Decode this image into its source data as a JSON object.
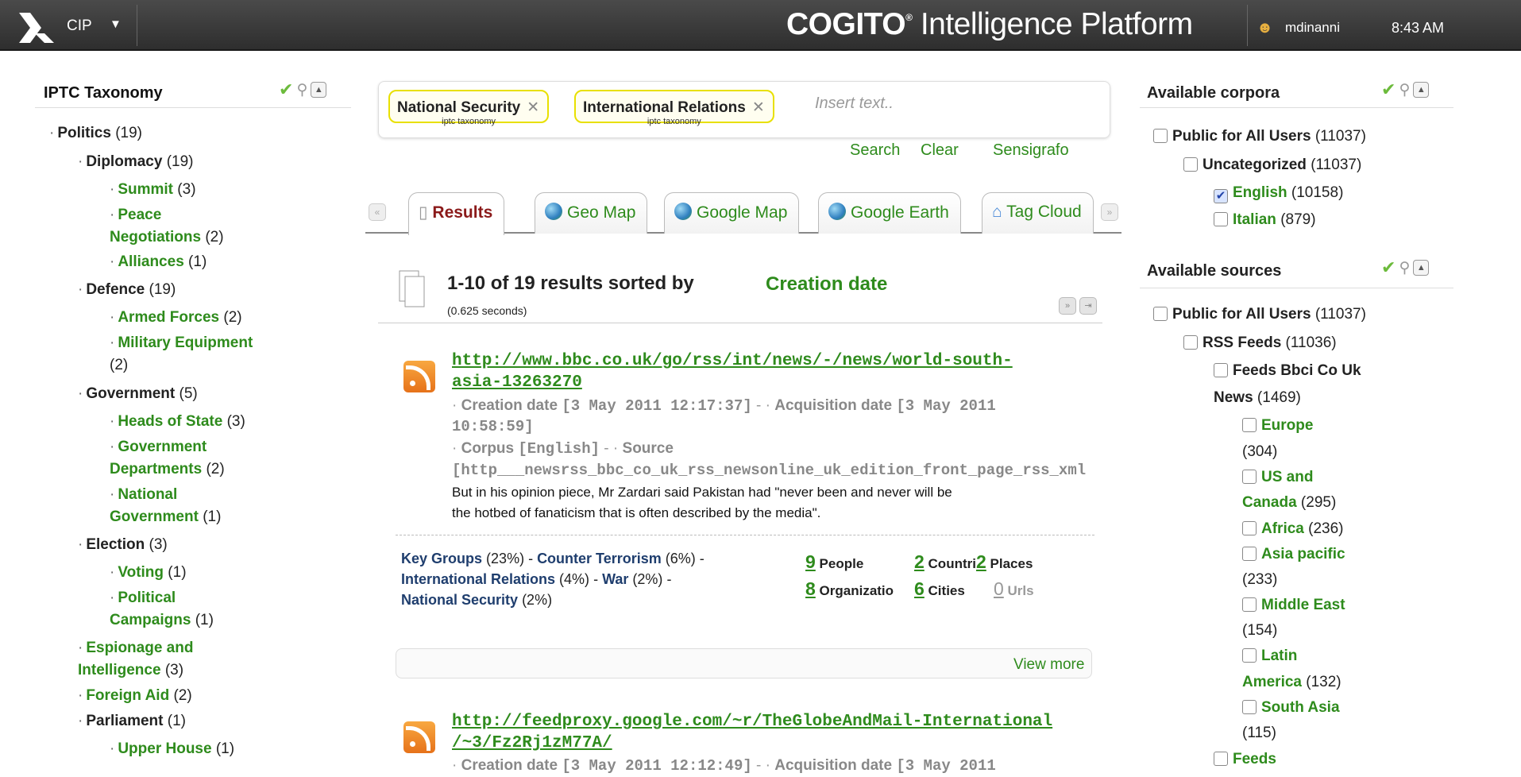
{
  "topbar": {
    "app_switcher": "CIP",
    "title_brand": "COGITO",
    "title_reg": "®",
    "title_rest": "Intelligence Platform",
    "username": "mdinanni",
    "time": "8:43 AM"
  },
  "left": {
    "title": "IPTC Taxonomy",
    "items": [
      {
        "label": "Politics",
        "count": "(19)"
      },
      {
        "label": "Diplomacy",
        "count": "(19)"
      },
      {
        "label": "Summit",
        "count": "(3)"
      },
      {
        "label": "Peace",
        "label2": "Negotiations",
        "count": "(2)"
      },
      {
        "label": "Alliances",
        "count": "(1)"
      },
      {
        "label": "Defence",
        "count": "(19)"
      },
      {
        "label": "Armed Forces",
        "count": "(2)"
      },
      {
        "label": "Military Equipment",
        "count": "(2)"
      },
      {
        "label": "Government",
        "count": "(5)"
      },
      {
        "label": "Heads of State",
        "count": "(3)"
      },
      {
        "label": "Government",
        "label2": "Departments",
        "count": "(2)"
      },
      {
        "label": "National",
        "label2": "Government",
        "count": "(1)"
      },
      {
        "label": "Election",
        "count": "(3)"
      },
      {
        "label": "Voting",
        "count": "(1)"
      },
      {
        "label": "Political",
        "label2": "Campaigns",
        "count": "(1)"
      },
      {
        "label": "Espionage and",
        "label2": "Intelligence",
        "count": "(3)"
      },
      {
        "label": "Foreign Aid",
        "count": "(2)"
      },
      {
        "label": "Parliament",
        "count": "(1)"
      },
      {
        "label": "Upper House",
        "count": "(1)"
      }
    ]
  },
  "search": {
    "chips": [
      {
        "label": "National Security",
        "sub": "iptc taxonomy"
      },
      {
        "label": "International Relations",
        "sub": "iptc taxonomy"
      }
    ],
    "placeholder": "Insert text..",
    "actions": {
      "search": "Search",
      "clear": "Clear",
      "sensigrafo": "Sensigrafo"
    }
  },
  "tabs": [
    "Results",
    "Geo Map",
    "Google Map",
    "Google Earth",
    "Tag Cloud"
  ],
  "results": {
    "summary": "1-10 of 19 results sorted by",
    "sort_field": "Creation date",
    "time": "(0.625 seconds)",
    "items": [
      {
        "url1": "http://www.bbc.co.uk/go/rss/int/news/-/news/world-south-",
        "url2": "asia-13263270",
        "creation_label": "Creation date",
        "creation_value": "[3 May 2011 12:17:37]",
        "sep": "-",
        "acq_label": "Acquisition date",
        "acq_value": "[3 May 2011",
        "acq_value2": "10:58:59]",
        "corpus_label": "Corpus",
        "corpus_value": "[English]",
        "source_label": "Source",
        "source_value": "[http___newsrss_bbc_co_uk_rss_newsonline_uk_edition_front_page_rss_xml",
        "snippet1": "But in his opinion piece, Mr Zardari said Pakistan had \"never been and never will be",
        "snippet2": "the hotbed of fanaticism that is often described by the media\".",
        "tags": [
          {
            "name": "Key Groups",
            "pct": "(23%)"
          },
          {
            "name": "Counter Terrorism",
            "pct": "(6%)"
          },
          {
            "name": "International Relations",
            "pct": "(4%)"
          },
          {
            "name": "War",
            "pct": "(2%)"
          },
          {
            "name": "National Security",
            "pct": "(2%)"
          }
        ],
        "stats": [
          {
            "n": "9",
            "label": "People"
          },
          {
            "n": "2",
            "label": "Countrie"
          },
          {
            "n": "2",
            "label": "Places"
          },
          {
            "n": "8",
            "label": "Organizatio"
          },
          {
            "n": "6",
            "label": "Cities"
          },
          {
            "n": "0",
            "label": "Urls"
          }
        ],
        "view_more": "View more"
      },
      {
        "url1": "http://feedproxy.google.com/~r/TheGlobeAndMail-International",
        "url2": "/~3/Fz2Rj1zM77A/",
        "creation_label": "Creation date",
        "creation_value": "[3 May 2011 12:12:49]",
        "sep": "-",
        "acq_label": "Acquisition date",
        "acq_value": "[3 May 2011"
      }
    ]
  },
  "corpora": {
    "title": "Available corpora",
    "items": [
      {
        "label": "Public for All Users",
        "count": "(11037)",
        "checked": false
      },
      {
        "label": "Uncategorized",
        "count": "(11037)",
        "checked": false
      },
      {
        "label": "English",
        "count": "(10158)",
        "checked": true
      },
      {
        "label": "Italian",
        "count": "(879)",
        "checked": false
      }
    ]
  },
  "sources": {
    "title": "Available sources",
    "items": [
      {
        "label": "Public for All Users",
        "count": "(11037)"
      },
      {
        "label": "RSS Feeds",
        "count": "(11036)"
      },
      {
        "label": "Feeds Bbci Co Uk",
        "label2": "News",
        "count": "(1469)"
      },
      {
        "label": "Europe",
        "count": "(304)"
      },
      {
        "label": "US and",
        "label2": "Canada",
        "count": "(295)"
      },
      {
        "label": "Africa",
        "count": "(236)"
      },
      {
        "label": "Asia pacific",
        "count": "(233)"
      },
      {
        "label": "Middle East",
        "count": "(154)"
      },
      {
        "label": "Latin",
        "label2": "America",
        "count": "(132)"
      },
      {
        "label": "South Asia",
        "count": "(115)"
      },
      {
        "label": "Feeds",
        "count": ""
      }
    ]
  },
  "colors": {
    "accent_green": "#2e8b1c",
    "navy": "#1f3e6e",
    "active_tab": "#8b1a1a",
    "topbar": "#3a3a3a"
  }
}
